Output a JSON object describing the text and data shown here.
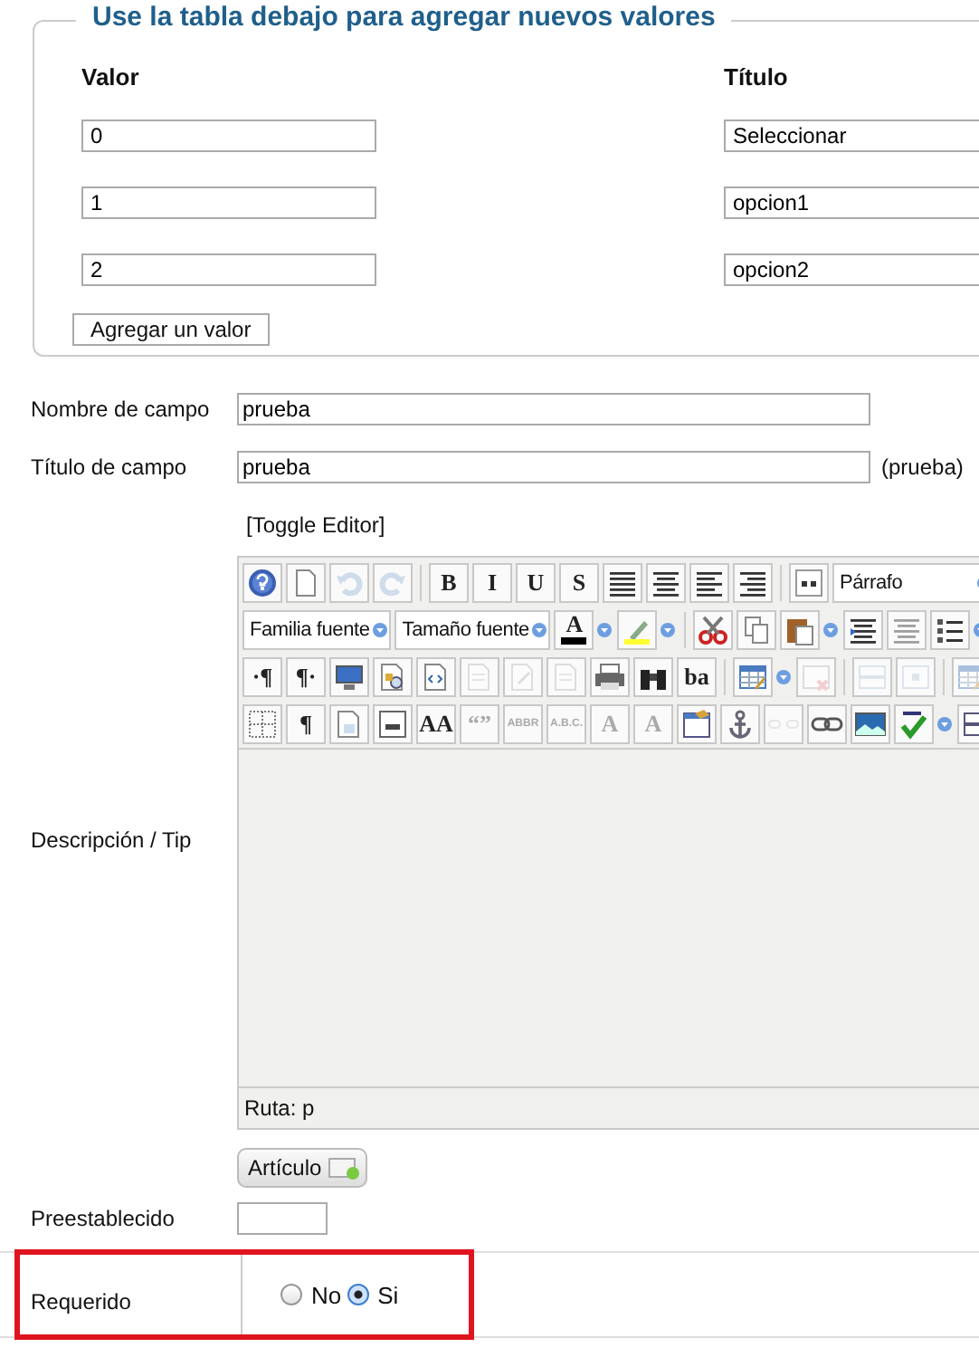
{
  "legend": "Use la tabla debajo para agregar nuevos valores",
  "values_table": {
    "columns": [
      "Valor",
      "Título"
    ],
    "rows": [
      [
        "0",
        "Seleccionar"
      ],
      [
        "1",
        "opcion1"
      ],
      [
        "2",
        "opcion2"
      ]
    ]
  },
  "add_button": "Agregar un valor",
  "fields": [
    {
      "label": "Nombre de campo",
      "value": "prueba"
    },
    {
      "label": "Título de campo",
      "value": "prueba",
      "note": "(prueba)"
    }
  ],
  "editor": {
    "toggle": "[Toggle Editor]",
    "toolbar": [
      [
        {
          "kind": "icon",
          "disabled": false
        },
        {
          "kind": "icon",
          "disabled": false
        },
        {
          "kind": "icon",
          "disabled": true
        },
        {
          "kind": "icon",
          "disabled": true
        },
        {
          "kind": "separator"
        },
        {
          "kind": "glyph",
          "label": "B",
          "disabled": false
        },
        {
          "kind": "glyph",
          "label": "I",
          "disabled": false
        },
        {
          "kind": "glyph",
          "label": "U",
          "disabled": false
        },
        {
          "kind": "glyph",
          "label": "S",
          "disabled": false
        },
        {
          "kind": "icon",
          "disabled": false
        },
        {
          "kind": "icon",
          "disabled": false
        },
        {
          "kind": "icon",
          "disabled": false
        },
        {
          "kind": "icon",
          "disabled": false
        },
        {
          "kind": "separator"
        },
        {
          "kind": "icon",
          "disabled": false
        },
        {
          "kind": "dropdown",
          "label": "Párrafo"
        }
      ],
      [
        {
          "kind": "dropdown",
          "label": "Familia fuente"
        },
        {
          "kind": "dropdown",
          "label": "Tamaño fuente"
        },
        {
          "kind": "colorpick",
          "label": "A",
          "color": "#000000"
        },
        {
          "kind": "icon",
          "disabled": false,
          "split": true
        },
        {
          "kind": "separator"
        },
        {
          "kind": "icon",
          "disabled": false
        },
        {
          "kind": "icon",
          "disabled": false
        },
        {
          "kind": "icon",
          "disabled": false,
          "split": true
        },
        {
          "kind": "icon",
          "disabled": false
        },
        {
          "kind": "icon",
          "disabled": true
        },
        {
          "kind": "icon",
          "disabled": false,
          "split": true
        }
      ],
      [
        {
          "kind": "glyph",
          "label": "·¶",
          "disabled": false
        },
        {
          "kind": "glyph",
          "label": "¶·",
          "disabled": false
        },
        {
          "kind": "icon",
          "disabled": false
        },
        {
          "kind": "icon",
          "disabled": false
        },
        {
          "kind": "icon",
          "disabled": false
        },
        {
          "kind": "icon",
          "disabled": true
        },
        {
          "kind": "icon",
          "disabled": true
        },
        {
          "kind": "icon",
          "disabled": true
        },
        {
          "kind": "icon",
          "disabled": false
        },
        {
          "kind": "icon",
          "disabled": false
        },
        {
          "kind": "glyph",
          "label": "ba",
          "disabled": false
        },
        {
          "kind": "separator"
        },
        {
          "kind": "icon",
          "disabled": false,
          "split": true
        },
        {
          "kind": "icon",
          "disabled": true
        },
        {
          "kind": "separator"
        },
        {
          "kind": "icon",
          "disabled": true
        },
        {
          "kind": "icon",
          "disabled": true
        },
        {
          "kind": "separator"
        },
        {
          "kind": "icon",
          "disabled": true
        }
      ],
      [
        {
          "kind": "icon",
          "disabled": false
        },
        {
          "kind": "glyph",
          "label": "¶",
          "disabled": false
        },
        {
          "kind": "icon",
          "disabled": false
        },
        {
          "kind": "icon",
          "disabled": false
        },
        {
          "kind": "glyph",
          "label": "AA",
          "disabled": false
        },
        {
          "kind": "glyph",
          "label": "“”",
          "disabled": true
        },
        {
          "kind": "glyph",
          "label": "ABBR",
          "disabled": true
        },
        {
          "kind": "glyph",
          "label": "A.B.C.",
          "disabled": true
        },
        {
          "kind": "glyph",
          "label": "A",
          "disabled": true
        },
        {
          "kind": "glyph",
          "label": "A",
          "disabled": true
        },
        {
          "kind": "icon",
          "disabled": false
        },
        {
          "kind": "icon",
          "disabled": false
        },
        {
          "kind": "icon",
          "disabled": true
        },
        {
          "kind": "icon",
          "disabled": false
        },
        {
          "kind": "icon",
          "disabled": false
        },
        {
          "kind": "icon",
          "disabled": false,
          "split": true
        },
        {
          "kind": "icon",
          "disabled": false
        }
      ]
    ],
    "path": "Ruta:  p"
  },
  "description_label": "Descripción / Tip",
  "article_button": "Artículo",
  "default_label": "Preestablecido",
  "required": {
    "label": "Requerido",
    "highlighted": true,
    "options": [
      {
        "label": "No",
        "selected": false
      },
      {
        "label": "Si",
        "selected": true
      }
    ]
  }
}
